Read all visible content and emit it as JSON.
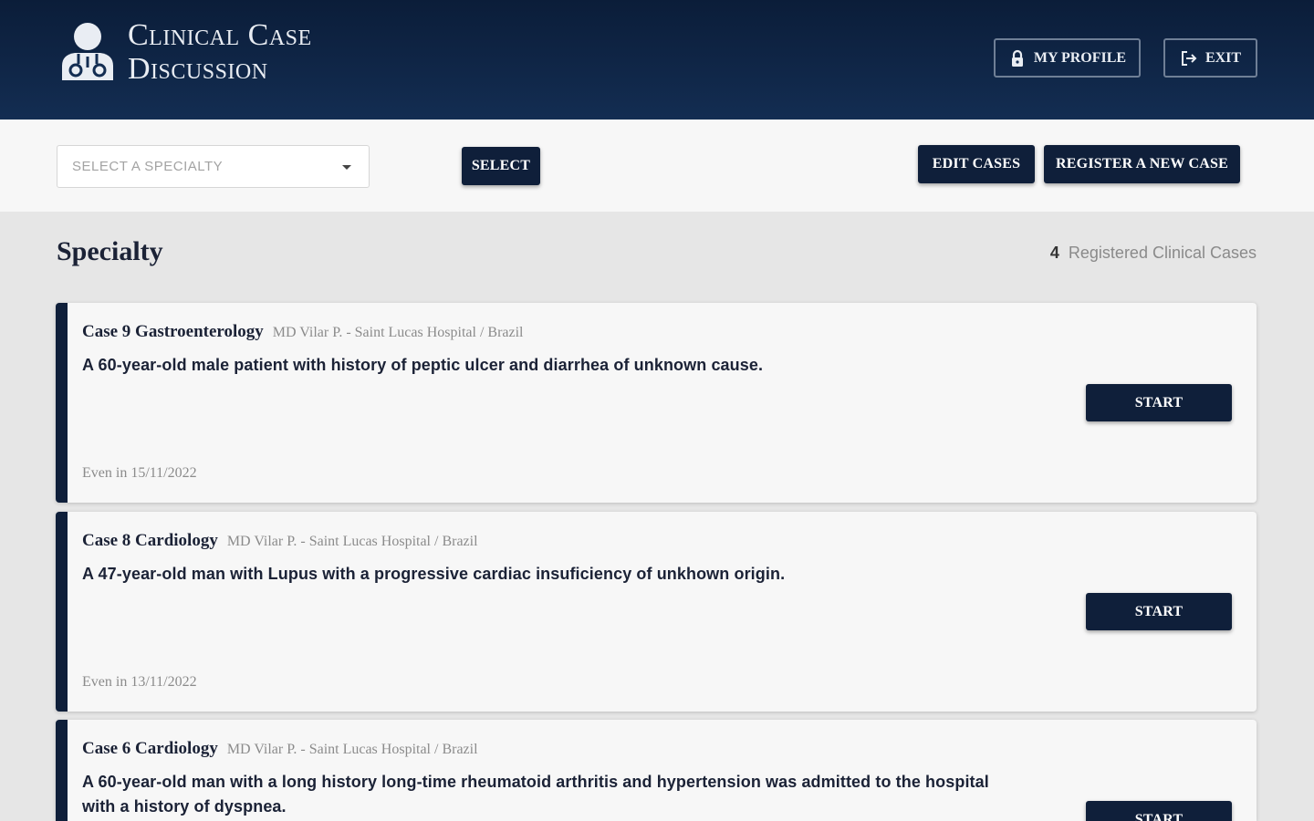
{
  "header": {
    "brand_line1": "Clinical Case",
    "brand_line2": "Discussion",
    "profile_label": "MY PROFILE",
    "exit_label": "EXIT",
    "icons": {
      "logo": "doctor-icon",
      "profile": "lock-icon",
      "exit": "sign-out-icon"
    }
  },
  "toolbar": {
    "specialty_placeholder": "SELECT A SPECIALTY",
    "select_label": "SELECT",
    "edit_label": "EDIT CASES",
    "register_label": "REGISTER A NEW CASE"
  },
  "main": {
    "section_title": "Specialty",
    "count": "4",
    "count_label": "Registered Clinical Cases",
    "cards": [
      {
        "title": "Case 9 Gastroenterology",
        "author": "MD Vilar P. - Saint Lucas Hospital / Brazil",
        "description": "A 60-year-old male patient with history of peptic ulcer and diarrhea of unknown cause.",
        "date": "Even in 15/11/2022",
        "start_label": "START"
      },
      {
        "title": "Case 8 Cardiology",
        "author": "MD Vilar P. - Saint Lucas Hospital / Brazil",
        "description": "A 47-year-old man with Lupus with a progressive cardiac insuficiency of unkhown origin.",
        "date": "Even in 13/11/2022",
        "start_label": "START"
      },
      {
        "title": "Case 6 Cardiology",
        "author": "MD Vilar P. - Saint Lucas Hospital / Brazil",
        "description": "A 60-year-old man with a long history long-time rheumatoid arthritis and hypertension was admitted to the hospital with a history of dyspnea.",
        "start_label": "START"
      }
    ]
  },
  "colors": {
    "navy": "#0f1f3a",
    "header_top": "#0b1d39",
    "header_bottom": "#132d52",
    "background": "#e6e6e6"
  }
}
